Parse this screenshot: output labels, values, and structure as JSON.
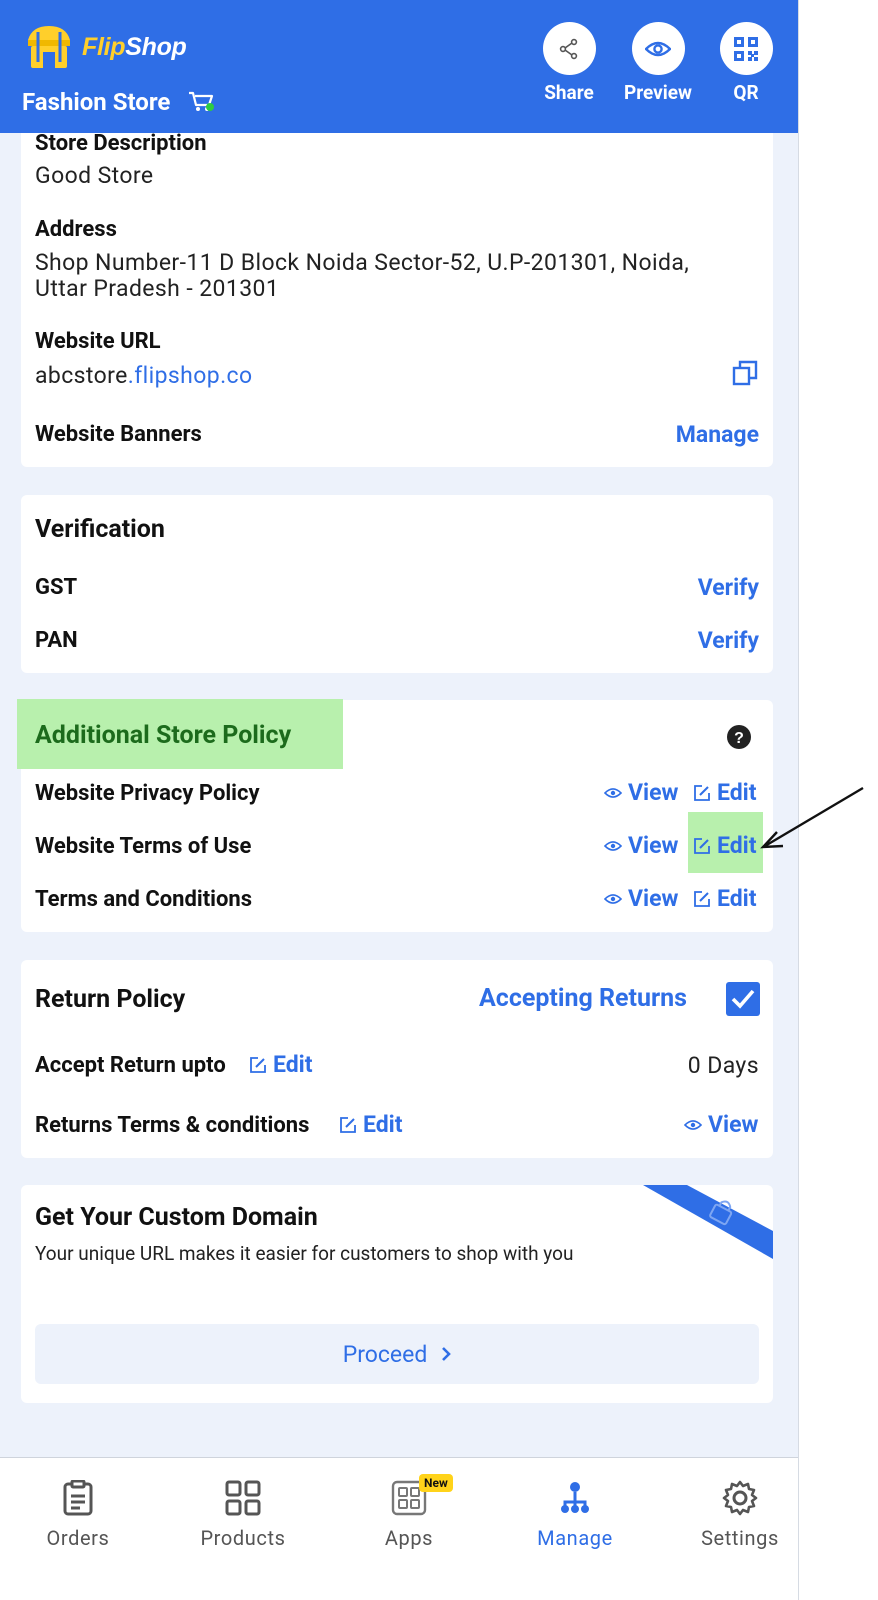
{
  "header": {
    "brand": "FlipShop",
    "brand_part1": "Flip",
    "brand_part2": "Shop",
    "store_name": "Fashion Store",
    "actions": [
      {
        "label": "Share",
        "icon": "share-icon"
      },
      {
        "label": "Preview",
        "icon": "eye-icon"
      },
      {
        "label": "QR",
        "icon": "qr-icon"
      }
    ]
  },
  "store_info": {
    "description_label": "Store Description",
    "description_value": "Good Store",
    "address_label": "Address",
    "address_line1": "Shop Number-11 D Block Noida Sector-52, U.P-201301, Noida,",
    "address_line2": "Uttar Pradesh - 201301",
    "website_url_label": "Website URL",
    "website_url_prefix": "abcstore",
    "website_url_domain": ".flipshop.co",
    "website_banners_label": "Website Banners",
    "manage_label": "Manage"
  },
  "verification": {
    "title": "Verification",
    "rows": [
      {
        "label": "GST",
        "action": "Verify"
      },
      {
        "label": "PAN",
        "action": "Verify"
      }
    ]
  },
  "additional_policy": {
    "title": "Additional Store Policy",
    "rows": [
      {
        "label": "Website Privacy Policy",
        "view": "View",
        "edit": "Edit"
      },
      {
        "label": "Website Terms of Use",
        "view": "View",
        "edit": "Edit"
      },
      {
        "label": "Terms and Conditions",
        "view": "View",
        "edit": "Edit"
      }
    ]
  },
  "return_policy": {
    "title": "Return Policy",
    "accepting_label": "Accepting Returns",
    "accepting_checked": true,
    "accept_upto_label": "Accept Return upto",
    "accept_upto_edit": "Edit",
    "accept_upto_value": "0 Days",
    "terms_label": "Returns Terms & conditions",
    "terms_edit": "Edit",
    "terms_view": "View"
  },
  "custom_domain": {
    "title": "Get Your Custom Domain",
    "subtitle": "Your unique URL makes it easier for customers to shop with you",
    "proceed_label": "Proceed"
  },
  "bottom_nav": {
    "items": [
      {
        "label": "Orders",
        "icon": "clipboard-icon"
      },
      {
        "label": "Products",
        "icon": "grid-icon"
      },
      {
        "label": "Apps",
        "icon": "apps-icon",
        "badge": "New"
      },
      {
        "label": "Manage",
        "icon": "manage-icon",
        "active": true
      },
      {
        "label": "Settings",
        "icon": "gear-icon"
      }
    ]
  },
  "colors": {
    "primary": "#2f6ee6",
    "highlight": "#b8f0ad",
    "background": "#edf2fb",
    "brand_yellow": "#ffcf2b"
  }
}
